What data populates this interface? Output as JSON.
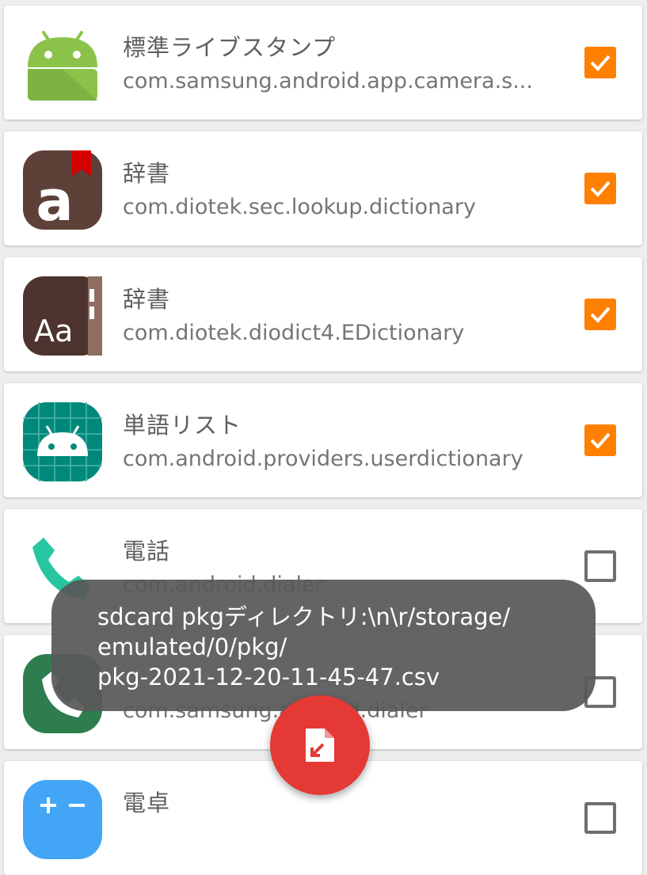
{
  "apps": [
    {
      "name": "標準ライブスタンプ",
      "package": "com.samsung.android.app.camera.s...",
      "checked": true,
      "icon": "android-robot-icon"
    },
    {
      "name": "辞書",
      "package": "com.diotek.sec.lookup.dictionary",
      "checked": true,
      "icon": "dictionary-a-icon"
    },
    {
      "name": "辞書",
      "package": "com.diotek.diodict4.EDictionary",
      "checked": true,
      "icon": "dictionary-aa-icon"
    },
    {
      "name": "単語リスト",
      "package": "com.android.providers.userdictionary",
      "checked": true,
      "icon": "user-dictionary-icon"
    },
    {
      "name": "電話",
      "package": "com.android.dialer",
      "checked": false,
      "icon": "phone-icon"
    },
    {
      "name": "",
      "package": "com.samsung.android.dialer",
      "checked": false,
      "icon": "samsung-phone-icon"
    },
    {
      "name": "電卓",
      "package": "",
      "checked": false,
      "icon": "calculator-icon"
    }
  ],
  "toast": {
    "line1": "sdcard pkgディレクトリ:\\n\\r/storage/",
    "line2": "emulated/0/pkg/",
    "line3": "pkg-2021-12-20-11-45-47.csv"
  },
  "fab": {
    "icon": "export-file-icon"
  },
  "colors": {
    "checkbox": "#ff7f00",
    "fab": "#e53935",
    "android_green": "#8bc34a"
  }
}
